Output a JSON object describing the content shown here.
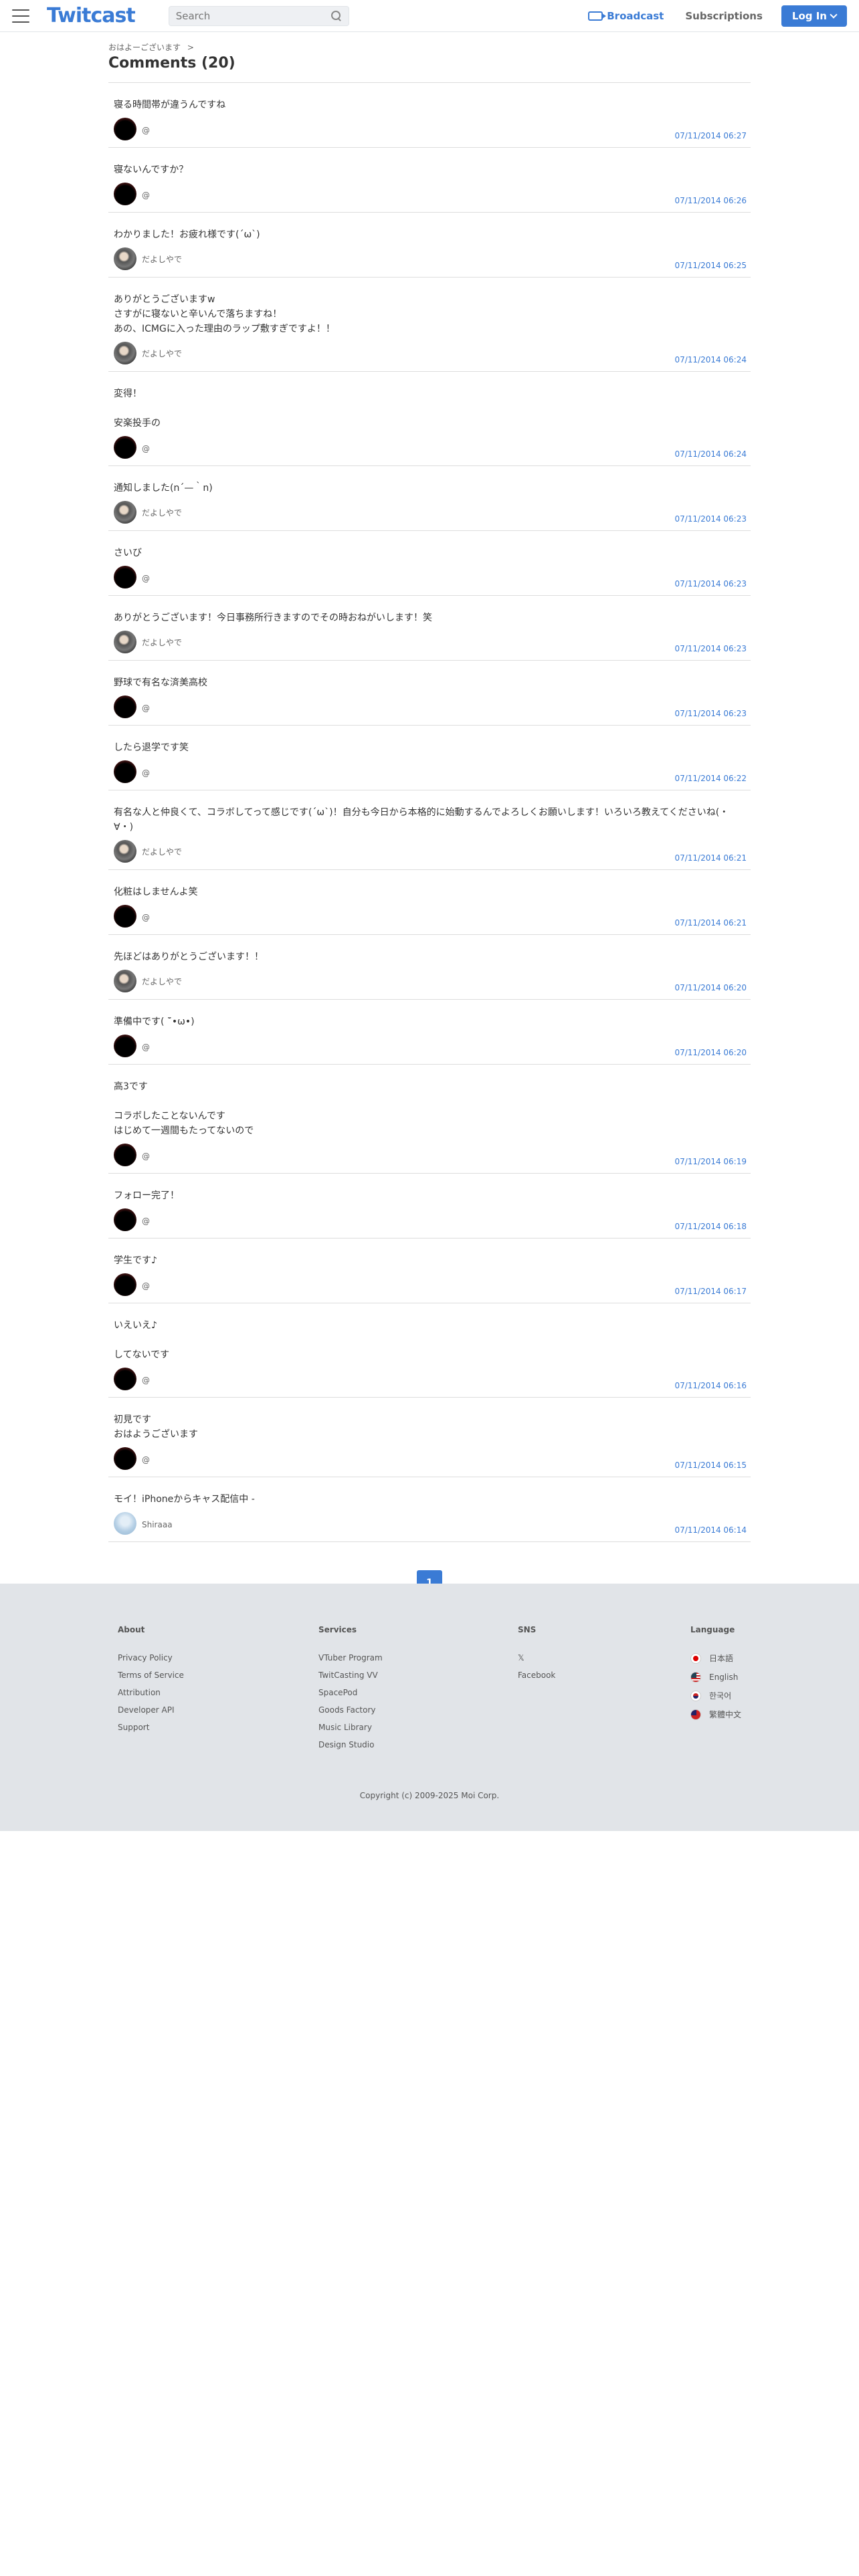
{
  "header": {
    "logo": "Twitcast",
    "search_placeholder": "Search",
    "broadcast_label": "Broadcast",
    "subscriptions_label": "Subscriptions",
    "login_label": "Log In"
  },
  "breadcrumb": {
    "item": "おはよーございます",
    "separator": ">"
  },
  "page_title": "Comments (20)",
  "comments": [
    {
      "text": "寝る時間帯が違うんですね",
      "author": "@",
      "date": "07/11/2014 06:27",
      "avatar": "black"
    },
    {
      "text": "寝ないんですか？",
      "author": "@",
      "date": "07/11/2014 06:26",
      "avatar": "black"
    },
    {
      "text": "わかりました！お疲れ様です(´ω`)",
      "author": "だよしやで",
      "date": "07/11/2014 06:25",
      "avatar": "photo"
    },
    {
      "text": "ありがとうございますw\nさすがに寝ないと辛いんで落ちますね！\nあの、ICMGに入った理由のラップ敷すぎですよ！！",
      "author": "だよしやで",
      "date": "07/11/2014 06:24",
      "avatar": "photo"
    },
    {
      "text": "変得！\n\n安楽投手の",
      "author": "@",
      "date": "07/11/2014 06:24",
      "avatar": "black"
    },
    {
      "text": "通知しました(n´—｀n)",
      "author": "だよしやで",
      "date": "07/11/2014 06:23",
      "avatar": "photo"
    },
    {
      "text": "さいび",
      "author": "@",
      "date": "07/11/2014 06:23",
      "avatar": "black"
    },
    {
      "text": "ありがとうございます！今日事務所行きますのでその時おねがいします！笑",
      "author": "だよしやで",
      "date": "07/11/2014 06:23",
      "avatar": "photo"
    },
    {
      "text": "野球で有名な済美高校",
      "author": "@",
      "date": "07/11/2014 06:23",
      "avatar": "black"
    },
    {
      "text": "したら退学です笑",
      "author": "@",
      "date": "07/11/2014 06:22",
      "avatar": "black"
    },
    {
      "text": "有名な人と仲良くて、コラボしてって感じです(´ω`)！自分も今日から本格的に始動するんでよろしくお願いします！いろいろ教えてくださいね(・∀・)",
      "author": "だよしやで",
      "date": "07/11/2014 06:21",
      "avatar": "photo"
    },
    {
      "text": "化粧はしませんよ笑",
      "author": "@",
      "date": "07/11/2014 06:21",
      "avatar": "black"
    },
    {
      "text": "先ほどはありがとうございます！！",
      "author": "だよしやで",
      "date": "07/11/2014 06:20",
      "avatar": "photo"
    },
    {
      "text": "準備中です( ¯̆•ω•)",
      "author": "@",
      "date": "07/11/2014 06:20",
      "avatar": "black"
    },
    {
      "text": "高3です\n\nコラボしたことないんです\nはじめて一週間もたってないので",
      "author": "@",
      "date": "07/11/2014 06:19",
      "avatar": "black"
    },
    {
      "text": "フォロー完了！",
      "author": "@",
      "date": "07/11/2014 06:18",
      "avatar": "black"
    },
    {
      "text": "学生です♪",
      "author": "@",
      "date": "07/11/2014 06:17",
      "avatar": "black"
    },
    {
      "text": "いえいえ♪\n\nしてないです",
      "author": "@",
      "date": "07/11/2014 06:16",
      "avatar": "black"
    },
    {
      "text": "初見です\nおはようございます",
      "author": "@",
      "date": "07/11/2014 06:15",
      "avatar": "black"
    },
    {
      "text": "モイ！iPhoneからキャス配信中 -",
      "author": "Shiraaa",
      "date": "07/11/2014 06:14",
      "avatar": "light"
    }
  ],
  "pagination": {
    "current": "1"
  },
  "footer": {
    "about": {
      "title": "About",
      "links": [
        "Privacy Policy",
        "Terms of Service",
        "Attribution",
        "Developer API",
        "Support"
      ]
    },
    "services": {
      "title": "Services",
      "links": [
        "VTuber Program",
        "TwitCasting VV",
        "SpacePod",
        "Goods Factory",
        "Music Library",
        "Design Studio"
      ]
    },
    "sns": {
      "title": "SNS",
      "links": [
        "𝕏",
        "Facebook"
      ]
    },
    "language": {
      "title": "Language",
      "items": [
        {
          "label": "日本語",
          "flag": "jp"
        },
        {
          "label": "English",
          "flag": "us"
        },
        {
          "label": "한국어",
          "flag": "kr"
        },
        {
          "label": "繁體中文",
          "flag": "tw"
        }
      ]
    },
    "copyright": "Copyright (c) 2009-2025 Moi Corp."
  },
  "colors": {
    "accent": "#3a7bd5",
    "footer_bg": "#e1e4e8"
  }
}
